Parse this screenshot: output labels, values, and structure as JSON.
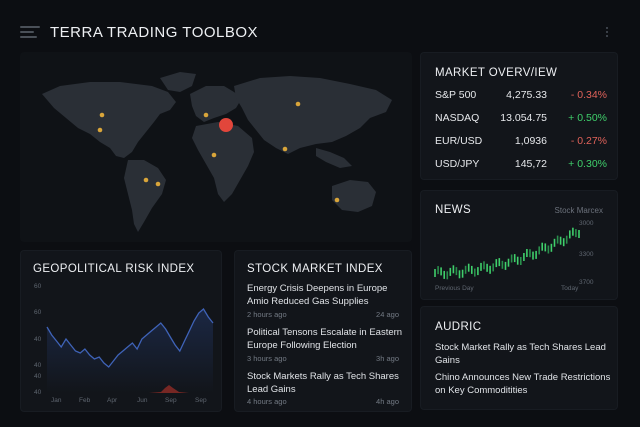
{
  "app": {
    "title": "TERRA TRADING TOOLBOX"
  },
  "market": {
    "title": "MARKET OVERV/IEW",
    "rows": [
      {
        "symbol": "S&P 500",
        "value": "4,275.33",
        "change": "- 0.34%",
        "direction": "down"
      },
      {
        "symbol": "NASDAQ",
        "value": "13.054.75",
        "change": "+ 0.50%",
        "direction": "up"
      },
      {
        "symbol": "EUR/USD",
        "value": "1,0936",
        "change": "- 0.27%",
        "direction": "down"
      },
      {
        "symbol": "USD/JPY",
        "value": "145,72",
        "change": "+ 0.30%",
        "direction": "up"
      }
    ]
  },
  "news": {
    "title": "NEWS",
    "source": "Stock Marcex",
    "y_ticks": [
      "3000",
      "3300",
      "3700"
    ],
    "x_labels": [
      "Previous Day",
      "Today"
    ]
  },
  "audric": {
    "title": "AUDRIC",
    "headlines": [
      "Stock Market Rally as Tech Shares Lead Gains",
      "Chino Announces New Trade Restrictions on Key Commoditities"
    ]
  },
  "risk": {
    "title": "GEOPOLITICAL RISK INDEX",
    "y_ticks": [
      "60",
      "60",
      "40",
      "40",
      "40",
      "40"
    ],
    "x_ticks": [
      "Jan",
      "Feb",
      "Apr",
      "Jun",
      "Sep",
      "Sep"
    ]
  },
  "stock_index": {
    "title": "STOCK MARKET INDEX",
    "items": [
      {
        "headline": "Energy Crisis Deepens in Europe Amio Reduced Gas Supplies",
        "time": "2 hours ago",
        "ago": "24 ago"
      },
      {
        "headline": "Political Tensons Escalate in Eastern Europe Following Election",
        "time": "3 hours ago",
        "ago": "3h ago"
      },
      {
        "headline": "Stock Markets Rally as Tech Shares Lead Gains",
        "time": "4 hours ago",
        "ago": "4h ago"
      }
    ]
  },
  "colors": {
    "accent_alert": "#e2463b",
    "marker": "#d9a53a",
    "positive": "#3fcf6b",
    "negative": "#e0625a",
    "risk_line": "#3f63b8"
  }
}
